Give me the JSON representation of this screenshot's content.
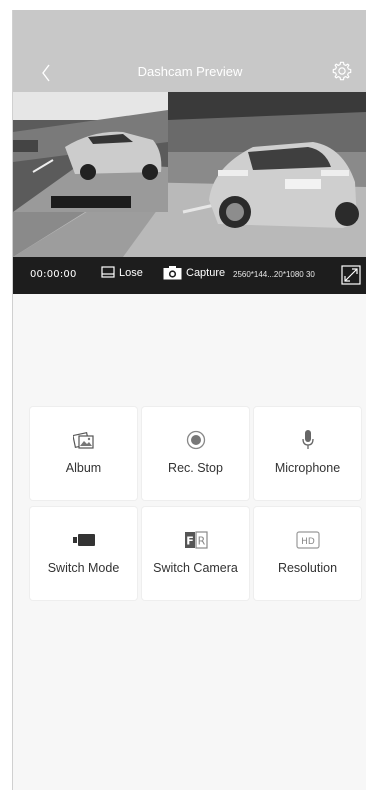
{
  "header": {
    "title": "Dashcam Preview",
    "back_icon": "chevron-left-icon",
    "settings_icon": "gear-icon"
  },
  "status": {
    "time": "00:00:00",
    "lose_label": "Lose",
    "capture_label": "Capture",
    "resolution": "2560*144...20*1080 30"
  },
  "actions": {
    "album": "Album",
    "rec_stop": "Rec. Stop",
    "microphone": "Microphone",
    "switch_mode": "Switch Mode",
    "switch_camera": "Switch Camera",
    "resolution": "Resolution"
  },
  "colors": {
    "header_bg": "#c8c8c8",
    "statusbar_bg": "#1d1d1d",
    "page_bg": "#f7f7f7",
    "tile_bg": "#ffffff"
  }
}
